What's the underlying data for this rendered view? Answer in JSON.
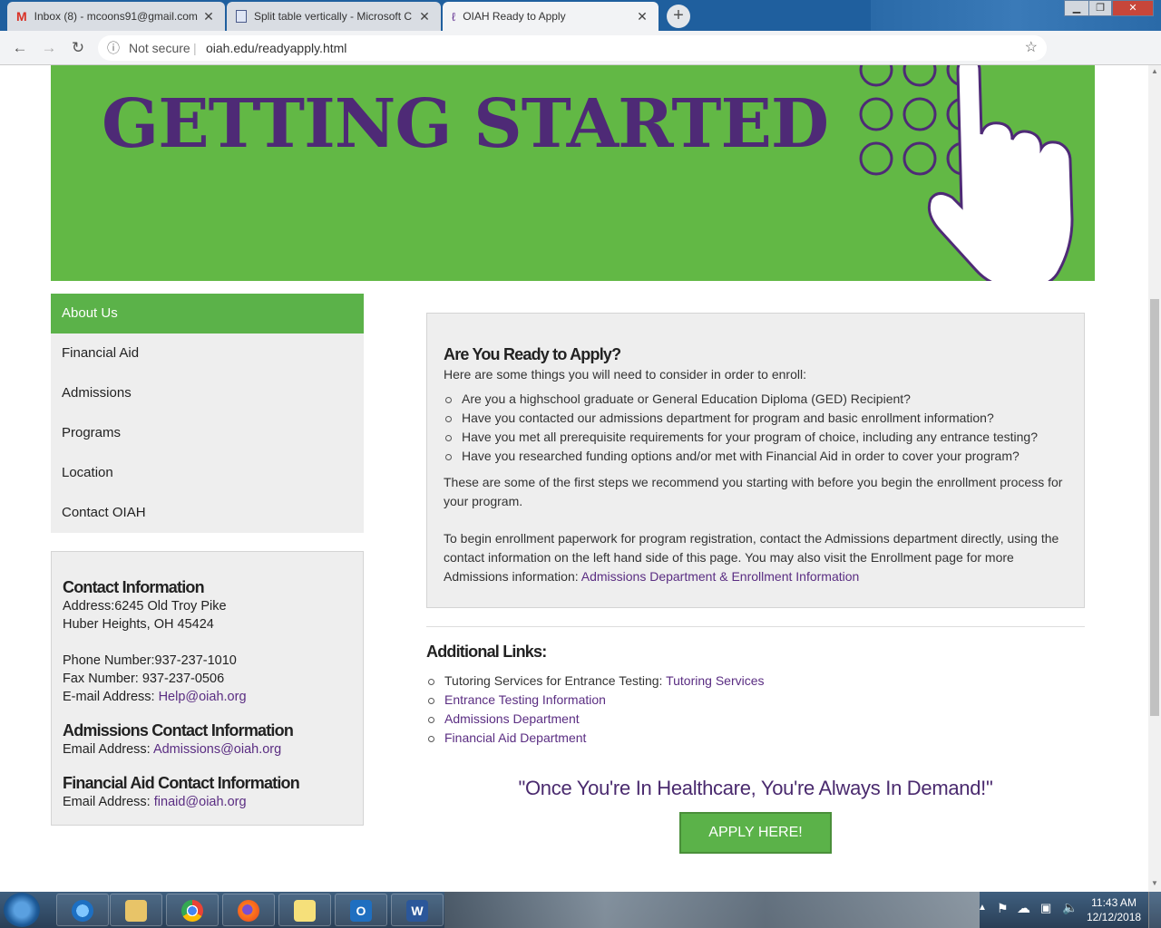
{
  "browser": {
    "tabs": [
      {
        "title": "Inbox (8) - mcoons91@gmail.com",
        "icon": "gmail-icon"
      },
      {
        "title": "Split table vertically - Microsoft C",
        "icon": "document-icon"
      },
      {
        "title": "OIAH Ready to Apply",
        "icon": "oiah-icon"
      }
    ],
    "security_label": "Not secure",
    "url": "oiah.edu/readyapply.html"
  },
  "banner": {
    "title": "GETTING STARTED",
    "colors": {
      "background": "#62b845",
      "text": "#4e2a76"
    }
  },
  "sidebar": {
    "items": [
      {
        "label": "About Us",
        "active": true
      },
      {
        "label": "Financial Aid"
      },
      {
        "label": "Admissions"
      },
      {
        "label": "Programs"
      },
      {
        "label": "Location"
      },
      {
        "label": "Contact OIAH"
      }
    ]
  },
  "contact": {
    "title": "Contact Information",
    "address_line1": "Address:6245 Old Troy Pike",
    "address_line2": "Huber Heights, OH 45424",
    "phone": "Phone Number:937-237-1010",
    "fax": "Fax Number: 937-237-0506",
    "email_label": "E-mail Address: ",
    "email": "Help@oiah.org",
    "admissions_title": "Admissions Contact Information",
    "admissions_email_label": "Email Address: ",
    "admissions_email": "Admissions@oiah.org",
    "finaid_title": "Financial Aid Contact Information",
    "finaid_email_label": "Email Address: ",
    "finaid_email": "finaid@oiah.org"
  },
  "main": {
    "heading": "Are You Ready to Apply?",
    "intro": "Here are some things you will need to consider in order to enroll:",
    "checklist": [
      "Are you a highschool graduate or General Education Diploma (GED) Recipient?",
      "Have you contacted our admissions department for program and basic enrollment information?",
      "Have you met all prerequisite requirements for your program of choice, including any entrance testing?",
      "Have you researched funding options and/or met with Financial Aid in order to cover your program?"
    ],
    "para1": "These are some of the first steps we recommend you starting with before you begin the enrollment process for your program.",
    "para2": "To begin enrollment paperwork for program registration, contact the Admissions department directly, using the contact information on the left hand side of this page. You may also visit the Enrollment page for more Admissions information: ",
    "para2_link": "Admissions Department & Enrollment Information"
  },
  "additional": {
    "title": "Additional Links:",
    "links": [
      {
        "prefix": "Tutoring Services for Entrance Testing: ",
        "label": "Tutoring Services"
      },
      {
        "prefix": "",
        "label": "Entrance Testing Information"
      },
      {
        "prefix": "",
        "label": "Admissions Department"
      },
      {
        "prefix": "",
        "label": "Financial Aid Department"
      }
    ]
  },
  "quote": "\"Once You're In Healthcare, You're Always In Demand!\"",
  "apply_button": "APPLY HERE!",
  "taskbar": {
    "apps": [
      "internet-explorer-icon",
      "file-explorer-icon",
      "chrome-icon",
      "firefox-icon",
      "sticky-notes-icon",
      "outlook-icon",
      "word-icon"
    ],
    "time": "11:43 AM",
    "date": "12/12/2018"
  },
  "colors": {
    "accent_green": "#5bb249",
    "link_purple": "#5a2d82",
    "brand_purple": "#4e2a76"
  }
}
